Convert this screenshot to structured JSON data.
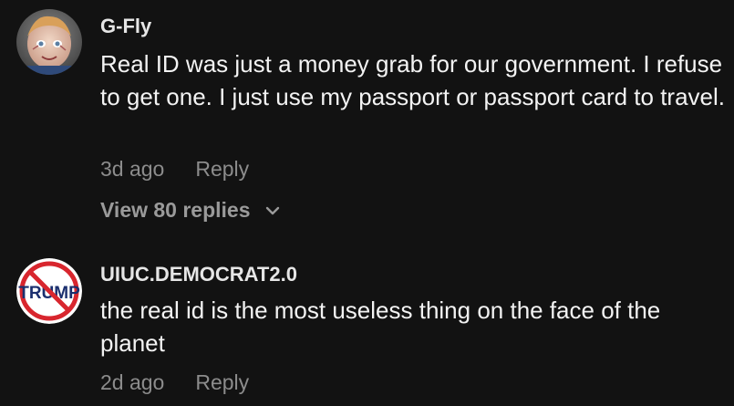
{
  "comments": [
    {
      "username": "G-Fly",
      "text": "Real ID was just a money grab for our government. I refuse to get one. I just use my passport or passport card to travel.",
      "time": "3d ago",
      "reply_label": "Reply",
      "view_replies": "View 80 replies"
    },
    {
      "username": "UIUC.DEMOCRAT2.0",
      "text": "the real id is the most useless thing on the face of the planet",
      "time": "2d ago",
      "reply_label": "Reply",
      "avatar_text": "TRUMP"
    }
  ],
  "colors": {
    "background": "#121212",
    "text": "#f3f3f3",
    "muted": "#8c8c8c",
    "prohibition_red": "#d8262e"
  },
  "icons": [
    "doll-avatar",
    "no-trump-avatar",
    "chevron-down-icon"
  ]
}
